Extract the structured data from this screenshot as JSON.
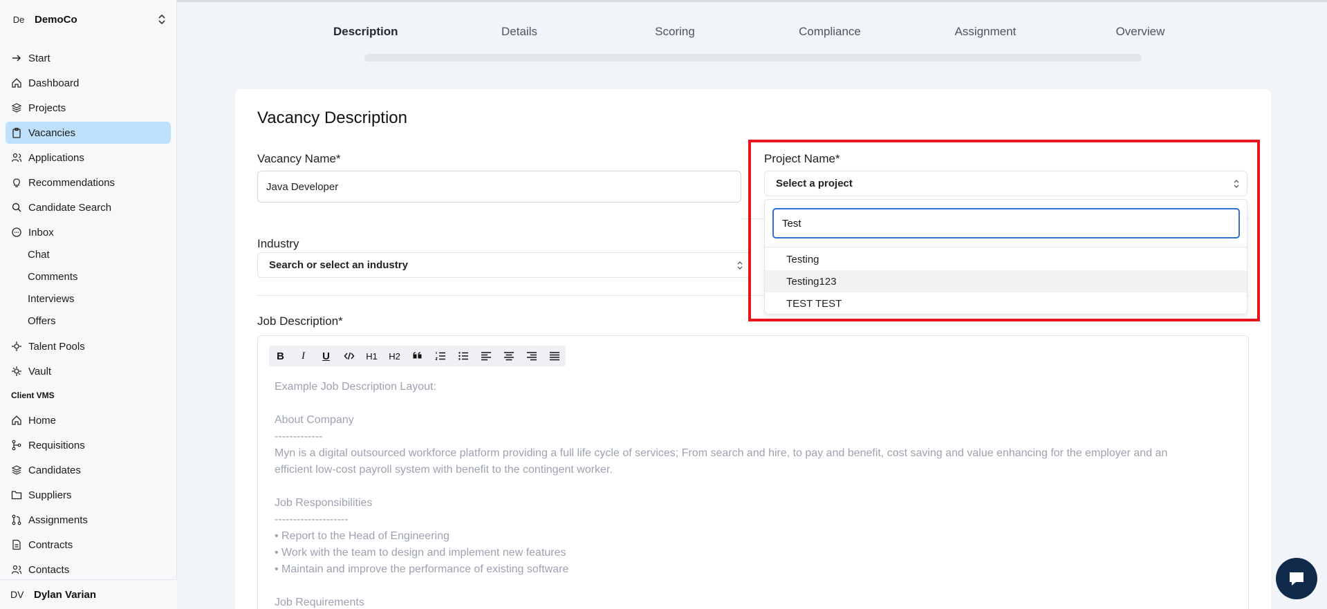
{
  "org": {
    "initials": "De",
    "name": "DemoCo"
  },
  "nav": {
    "items": [
      {
        "label": "Start",
        "icon": "arrow-right-icon"
      },
      {
        "label": "Dashboard",
        "icon": "home-icon"
      },
      {
        "label": "Projects",
        "icon": "layers-icon"
      },
      {
        "label": "Vacancies",
        "icon": "clipboard-icon"
      },
      {
        "label": "Applications",
        "icon": "users-icon"
      },
      {
        "label": "Recommendations",
        "icon": "lightbulb-icon"
      },
      {
        "label": "Candidate Search",
        "icon": "search-icon"
      },
      {
        "label": "Inbox",
        "icon": "message-icon"
      },
      {
        "label": "Chat"
      },
      {
        "label": "Comments"
      },
      {
        "label": "Interviews"
      },
      {
        "label": "Offers"
      },
      {
        "label": "Talent Pools",
        "icon": "pool-icon"
      },
      {
        "label": "Vault",
        "icon": "vault-icon"
      },
      {
        "label": "Home",
        "icon": "home-icon"
      },
      {
        "label": "Requisitions",
        "icon": "branch-icon"
      },
      {
        "label": "Candidates",
        "icon": "layers-icon"
      },
      {
        "label": "Suppliers",
        "icon": "folder-icon"
      },
      {
        "label": "Assignments",
        "icon": "git-pull-icon"
      },
      {
        "label": "Contracts",
        "icon": "document-icon"
      },
      {
        "label": "Contacts",
        "icon": "users-icon"
      }
    ],
    "section_client_vms": "Client VMS"
  },
  "user": {
    "initials": "DV",
    "name": "Dylan Varian"
  },
  "steps": [
    "Description",
    "Details",
    "Scoring",
    "Compliance",
    "Assignment",
    "Overview"
  ],
  "form": {
    "title": "Vacancy Description",
    "vacancy_name_label": "Vacancy Name*",
    "vacancy_name_value": "Java Developer",
    "industry_label": "Industry",
    "industry_placeholder": "Search or select an industry",
    "job_description_label": "Job Description*",
    "toolbar": [
      "B",
      "I",
      "U",
      "code",
      "H1",
      "H2",
      "quote",
      "ordered-list",
      "bullet-list",
      "align-left",
      "align-center",
      "align-right",
      "justify"
    ],
    "placeholder_lines": [
      "Example Job Description Layout:",
      "",
      "About Company",
      "-------------",
      "Myn is a digital outsourced workforce platform providing a full life cycle of services; From search and hire, to pay and benefit, cost saving and value enhancing for the employer and an",
      "efficient low-cost payroll system with benefit to the contingent worker.",
      "",
      "Job Responsibilities",
      "--------------------",
      "• Report to the Head of Engineering",
      "• Work with the team to design and implement new features",
      "• Maintain and improve the performance of existing software",
      "",
      "Job Requirements"
    ]
  },
  "project": {
    "label": "Project Name*",
    "placeholder": "Select a project",
    "search_value": "Test",
    "options": [
      "Testing",
      "Testing123",
      "TEST TEST"
    ],
    "highlight_color": "#e8141b"
  },
  "colors": {
    "active_nav": "#bfe0fb",
    "focus": "#2f6fd1",
    "chat": "#0f2a4a"
  }
}
